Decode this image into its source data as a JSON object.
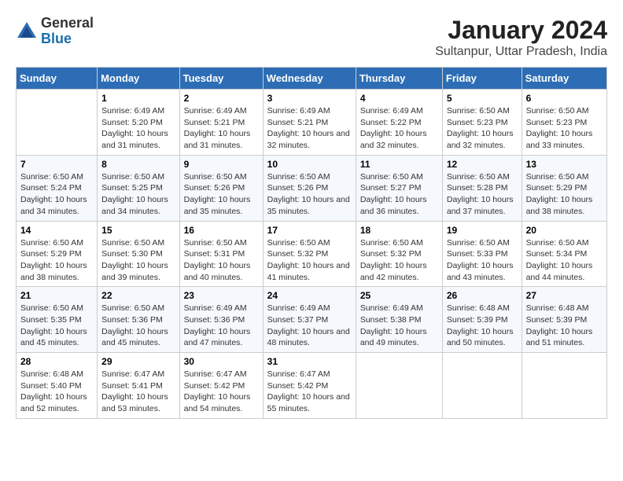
{
  "logo": {
    "general": "General",
    "blue": "Blue"
  },
  "title": "January 2024",
  "subtitle": "Sultanpur, Uttar Pradesh, India",
  "days_of_week": [
    "Sunday",
    "Monday",
    "Tuesday",
    "Wednesday",
    "Thursday",
    "Friday",
    "Saturday"
  ],
  "weeks": [
    [
      {
        "day": "",
        "sunrise": "",
        "sunset": "",
        "daylight": ""
      },
      {
        "day": "1",
        "sunrise": "Sunrise: 6:49 AM",
        "sunset": "Sunset: 5:20 PM",
        "daylight": "Daylight: 10 hours and 31 minutes."
      },
      {
        "day": "2",
        "sunrise": "Sunrise: 6:49 AM",
        "sunset": "Sunset: 5:21 PM",
        "daylight": "Daylight: 10 hours and 31 minutes."
      },
      {
        "day": "3",
        "sunrise": "Sunrise: 6:49 AM",
        "sunset": "Sunset: 5:21 PM",
        "daylight": "Daylight: 10 hours and 32 minutes."
      },
      {
        "day": "4",
        "sunrise": "Sunrise: 6:49 AM",
        "sunset": "Sunset: 5:22 PM",
        "daylight": "Daylight: 10 hours and 32 minutes."
      },
      {
        "day": "5",
        "sunrise": "Sunrise: 6:50 AM",
        "sunset": "Sunset: 5:23 PM",
        "daylight": "Daylight: 10 hours and 32 minutes."
      },
      {
        "day": "6",
        "sunrise": "Sunrise: 6:50 AM",
        "sunset": "Sunset: 5:23 PM",
        "daylight": "Daylight: 10 hours and 33 minutes."
      }
    ],
    [
      {
        "day": "7",
        "sunrise": "Sunrise: 6:50 AM",
        "sunset": "Sunset: 5:24 PM",
        "daylight": "Daylight: 10 hours and 34 minutes."
      },
      {
        "day": "8",
        "sunrise": "Sunrise: 6:50 AM",
        "sunset": "Sunset: 5:25 PM",
        "daylight": "Daylight: 10 hours and 34 minutes."
      },
      {
        "day": "9",
        "sunrise": "Sunrise: 6:50 AM",
        "sunset": "Sunset: 5:26 PM",
        "daylight": "Daylight: 10 hours and 35 minutes."
      },
      {
        "day": "10",
        "sunrise": "Sunrise: 6:50 AM",
        "sunset": "Sunset: 5:26 PM",
        "daylight": "Daylight: 10 hours and 35 minutes."
      },
      {
        "day": "11",
        "sunrise": "Sunrise: 6:50 AM",
        "sunset": "Sunset: 5:27 PM",
        "daylight": "Daylight: 10 hours and 36 minutes."
      },
      {
        "day": "12",
        "sunrise": "Sunrise: 6:50 AM",
        "sunset": "Sunset: 5:28 PM",
        "daylight": "Daylight: 10 hours and 37 minutes."
      },
      {
        "day": "13",
        "sunrise": "Sunrise: 6:50 AM",
        "sunset": "Sunset: 5:29 PM",
        "daylight": "Daylight: 10 hours and 38 minutes."
      }
    ],
    [
      {
        "day": "14",
        "sunrise": "Sunrise: 6:50 AM",
        "sunset": "Sunset: 5:29 PM",
        "daylight": "Daylight: 10 hours and 38 minutes."
      },
      {
        "day": "15",
        "sunrise": "Sunrise: 6:50 AM",
        "sunset": "Sunset: 5:30 PM",
        "daylight": "Daylight: 10 hours and 39 minutes."
      },
      {
        "day": "16",
        "sunrise": "Sunrise: 6:50 AM",
        "sunset": "Sunset: 5:31 PM",
        "daylight": "Daylight: 10 hours and 40 minutes."
      },
      {
        "day": "17",
        "sunrise": "Sunrise: 6:50 AM",
        "sunset": "Sunset: 5:32 PM",
        "daylight": "Daylight: 10 hours and 41 minutes."
      },
      {
        "day": "18",
        "sunrise": "Sunrise: 6:50 AM",
        "sunset": "Sunset: 5:32 PM",
        "daylight": "Daylight: 10 hours and 42 minutes."
      },
      {
        "day": "19",
        "sunrise": "Sunrise: 6:50 AM",
        "sunset": "Sunset: 5:33 PM",
        "daylight": "Daylight: 10 hours and 43 minutes."
      },
      {
        "day": "20",
        "sunrise": "Sunrise: 6:50 AM",
        "sunset": "Sunset: 5:34 PM",
        "daylight": "Daylight: 10 hours and 44 minutes."
      }
    ],
    [
      {
        "day": "21",
        "sunrise": "Sunrise: 6:50 AM",
        "sunset": "Sunset: 5:35 PM",
        "daylight": "Daylight: 10 hours and 45 minutes."
      },
      {
        "day": "22",
        "sunrise": "Sunrise: 6:50 AM",
        "sunset": "Sunset: 5:36 PM",
        "daylight": "Daylight: 10 hours and 45 minutes."
      },
      {
        "day": "23",
        "sunrise": "Sunrise: 6:49 AM",
        "sunset": "Sunset: 5:36 PM",
        "daylight": "Daylight: 10 hours and 47 minutes."
      },
      {
        "day": "24",
        "sunrise": "Sunrise: 6:49 AM",
        "sunset": "Sunset: 5:37 PM",
        "daylight": "Daylight: 10 hours and 48 minutes."
      },
      {
        "day": "25",
        "sunrise": "Sunrise: 6:49 AM",
        "sunset": "Sunset: 5:38 PM",
        "daylight": "Daylight: 10 hours and 49 minutes."
      },
      {
        "day": "26",
        "sunrise": "Sunrise: 6:48 AM",
        "sunset": "Sunset: 5:39 PM",
        "daylight": "Daylight: 10 hours and 50 minutes."
      },
      {
        "day": "27",
        "sunrise": "Sunrise: 6:48 AM",
        "sunset": "Sunset: 5:39 PM",
        "daylight": "Daylight: 10 hours and 51 minutes."
      }
    ],
    [
      {
        "day": "28",
        "sunrise": "Sunrise: 6:48 AM",
        "sunset": "Sunset: 5:40 PM",
        "daylight": "Daylight: 10 hours and 52 minutes."
      },
      {
        "day": "29",
        "sunrise": "Sunrise: 6:47 AM",
        "sunset": "Sunset: 5:41 PM",
        "daylight": "Daylight: 10 hours and 53 minutes."
      },
      {
        "day": "30",
        "sunrise": "Sunrise: 6:47 AM",
        "sunset": "Sunset: 5:42 PM",
        "daylight": "Daylight: 10 hours and 54 minutes."
      },
      {
        "day": "31",
        "sunrise": "Sunrise: 6:47 AM",
        "sunset": "Sunset: 5:42 PM",
        "daylight": "Daylight: 10 hours and 55 minutes."
      },
      {
        "day": "",
        "sunrise": "",
        "sunset": "",
        "daylight": ""
      },
      {
        "day": "",
        "sunrise": "",
        "sunset": "",
        "daylight": ""
      },
      {
        "day": "",
        "sunrise": "",
        "sunset": "",
        "daylight": ""
      }
    ]
  ]
}
